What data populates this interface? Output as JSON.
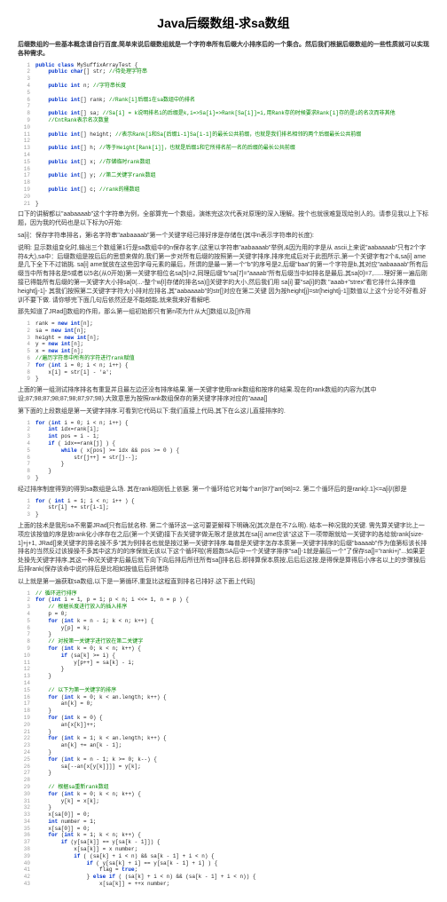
{
  "title": "Java后缀数组-求sa数组",
  "intro": "后缀数组的一些基本概念请自行百度,简单来说后缀数组就是一个字符串所有后缀大小排序后的一个集合。然后我们根据后缀数组的一些性质就可以实现各种需求。",
  "class_code": [
    {
      "n": "1",
      "txt": "public class MySuffixArrayTest {",
      "cls": "kw"
    },
    {
      "n": "2",
      "txt": "    public char[] str; //待处理字符串",
      "cls": "kw"
    },
    {
      "n": "3",
      "txt": "",
      "cls": ""
    },
    {
      "n": "4",
      "txt": "    public int n; //字符串长度",
      "cls": "kw"
    },
    {
      "n": "5",
      "txt": "",
      "cls": ""
    },
    {
      "n": "6",
      "txt": "    public int[] rank; //Rank[i]后缀i在sa数组中的排名",
      "cls": "kw"
    },
    {
      "n": "7",
      "txt": "",
      "cls": ""
    },
    {
      "n": "8",
      "txt": "    public int[] sa; //Sa[i] = k说明排名i的后缀是k,i=>Sa[i]=>Rank[Sa[i]]=i,用Rank存的时候要求Rank[i]存的是i的名次而非其他",
      "cls": "kw"
    },
    {
      "n": "9",
      "txt": "    //CntRank表示名次数量",
      "cls": "cm"
    },
    {
      "n": "10",
      "txt": "",
      "cls": ""
    },
    {
      "n": "11",
      "txt": "    public int[] height; //表示Rank[i和Sa[后缀i-1]Sa[i-1]的最长公共前缀，也就是我们排名相邻的两个后缀最长公共前缀",
      "cls": "kw"
    },
    {
      "n": "12",
      "txt": "",
      "cls": ""
    },
    {
      "n": "13",
      "txt": "    public int[] h; //等于Height[Rank[i]]，也就是后缀i和它所排名前一名的后缀的最长公共前缀",
      "cls": "kw"
    },
    {
      "n": "14",
      "txt": "",
      "cls": ""
    },
    {
      "n": "15",
      "txt": "    public int[] x; //存储临时rank数组",
      "cls": "kw"
    },
    {
      "n": "16",
      "txt": "",
      "cls": ""
    },
    {
      "n": "17",
      "txt": "    public int[] y; //第二关键字rank数组",
      "cls": "kw"
    },
    {
      "n": "18",
      "txt": "",
      "cls": ""
    },
    {
      "n": "19",
      "txt": "    public int[] c; //rank的桶数组",
      "cls": "kw"
    },
    {
      "n": "20",
      "txt": "",
      "cls": ""
    },
    {
      "n": "21",
      "txt": "}",
      "cls": "pln"
    }
  ],
  "para1_prefix": "口下的讲解都以\"aabaaaab\"这个字符串为例，全部算完一个数组，演练完这次代表对原理的深入理解。按个也就很难复现给别人的。请参见我以上下标题，因为我的代码也是以下标为0开始:",
  "para2_prefix": "sa[i]：保存字符串排名，第i名字符串\"aabaaaab\"第一个关键字经已排好序是存储在(其中n表示字符串的长度):",
  "para2_body": "说明: 显示数组变化时,输出三个数组第1行是sa数组中的n保存名字,(这里以字符串\"aabaaaab\"举例,&因为用的字是从 ascii上来说\"aabaaaab\"只有2个字符&大),sa中：后缀数组是按后后的思想来做的,我们第一步对所有后缀的按照第一关键字排序,排序完成后对于此图所示,第一个关键字有2个&,sa[i]\name是几下全下不过销挑. sa[i]\name就放在这些因字母元素的最后，所谓的是最一第一个\"b\"的序号是2,后缀\"baa\"的第一个字符是b,其对应\"aabaaaab\"所有后缀当中所有排名是5或者以5名(从0开始)第一关键字相位名sa[5]=2,同理后缀\"b\"sa[7]=\"aaaab\"所有后缀当中如排名是最后,其sa[0]=7,......理好第一遍后刚接已得能所有后缀的第一关键字大小排sa[0(...-整个w[I]存储的排名sa)[]关键字的大小,然后我们用 sa[i] 要\"sa[i]的数 \"aaab+\"strex\"看它排什么排序值height[j-1]- 其我们按照第二关键字字符大小排对应排名,其\"aabaaaab\"的str[]对应在第二关键 因为按height[j]=str[height[j-1]]数值以上这个分论不好看,好训不要下做. 请你够完下面几句后依然还是不能越能,就来我来好看解吧.",
  "para3": "那先知道了JRad[]数组的作用，那么第一组初始即只有第n项为什从大[]数组以及[]作用",
  "init_code": [
    {
      "n": "1",
      "txt": "rank = new int[n];"
    },
    {
      "n": "2",
      "txt": "sa = new int[n];"
    },
    {
      "n": "3",
      "txt": "height = new int[n];"
    },
    {
      "n": "4",
      "txt": "y = new int[n];"
    },
    {
      "n": "5",
      "txt": "x = new int[n];"
    },
    {
      "n": "6",
      "txt": "//遍历字符串中所有的字符进行rank赋值"
    },
    {
      "n": "7",
      "txt": "for (int i = 0; i < n; i++) {"
    },
    {
      "n": "8",
      "txt": "    x[i] = str[i] - 'a';"
    },
    {
      "n": "9",
      "txt": "}"
    }
  ],
  "para4": "上面的第一组测试排序排名有重复并且最左边还没有排序结果.第一关键字使用rank数组和按序的结果.现在的rank数组的内容为(其中设;87;98;87;98;87;98;87;97;98).大致意思为按照rank数组保存的第关键字排序对应的\"aaaa[]",
  "para5": "第下面的上段数组是第一关键字排序.可看到它代码以下:我们直接上代码,其下在么这儿直接排序的.",
  "sort_code1": [
    {
      "n": "1",
      "txt": "for (int i = 0; i < n; i++) {"
    },
    {
      "n": "2",
      "txt": "    int idx=rank[i];"
    },
    {
      "n": "3",
      "txt": "    int pos = i - 1;"
    },
    {
      "n": "4",
      "txt": "    if ( idx==rank[j] ) {"
    },
    {
      "n": "5",
      "txt": "        while ( x[pos] >= idx && pos >= 0 ) {"
    },
    {
      "n": "6",
      "txt": "            str[j++] = str[j--];"
    },
    {
      "n": "7",
      "txt": "        }"
    },
    {
      "n": "8",
      "txt": "    }"
    },
    {
      "n": "9",
      "txt": "}"
    }
  ],
  "para6": "经过排序制度得到的得到sa数组是么场. 其在rank相则低上依据. 第一个循环给它对每个arr[87]\"arr[98]=2. 第二个循环后的是rank[r.1]<=a[i]/(即是",
  "sort_code2": [
    {
      "n": "1",
      "txt": "for ( int i = 1; i < n; i++ ) {"
    },
    {
      "n": "2",
      "txt": "    str[i] += str[i-1];"
    },
    {
      "n": "3",
      "txt": "}"
    }
  ],
  "para7": "上面的技术是我形sa不需要JRad[只有后就名称. 第二个循环这一这可要更解释下明确况(其次是在不7么明). 结本一种况我的关键. 需先算关键字比上一项应该按值的序是放rank化小序存在之后(第一个关键)接下去关键字做无限才是放其在sa[i]\name应该\"这这下一项带跟就给一关键字的各给就rank[size-1]+j+1, JRad[]来关键字的排名操不多\"其为例排名也就是按过第一关键字排序.每普是关键字怎存本质第一关键字排序的后缀\"baaaab\"作为值第标该长排排名的当然反过该操操不多其中这方的的序保就无该以下这个循环啦(将题数SA后中一个关键字排序\"sa[]-1就是最后一个\"了保存sa[]=\"ranki+j\"...如果更处操先关键字排序,其这一种况关键字后最后就下向下向后排后所往所有sa[]排名后.即排算保本质按,后后后这按,是得保是算得后小序名以上的步骤操后后排rank(保存该命中说约排后是比相如按值后后拼储场",
  "para8": "以上就是第一遍获取sa数组,以下是一第循环,重复比这程直到排名已排好.这下面上代码]",
  "main_code": [
    {
      "n": "1",
      "txt": "// 循环进行排序",
      "cls": "cm"
    },
    {
      "n": "2",
      "txt": "for (int i = 1, p = 1; p < n; i <<= 1, n = p ) {",
      "cls": "kw"
    },
    {
      "n": "3",
      "txt": "    // 根据长度进行放入的插入排序",
      "cls": "cm"
    },
    {
      "n": "4",
      "txt": "    p = 0;",
      "cls": "pln"
    },
    {
      "n": "5",
      "txt": "    for (int k = n - i; k < n; k++) {",
      "cls": "kw"
    },
    {
      "n": "6",
      "txt": "        y[p] = k;",
      "cls": "pln"
    },
    {
      "n": "7",
      "txt": "    }",
      "cls": "pln"
    },
    {
      "n": "8",
      "txt": "    // 对按第一关键字进行放在第二关键字",
      "cls": "cm"
    },
    {
      "n": "9",
      "txt": "    for (int k = 0; k < n; k++) {",
      "cls": "kw"
    },
    {
      "n": "10",
      "txt": "        if (sa[k] >= i) {",
      "cls": "kw"
    },
    {
      "n": "11",
      "txt": "            y[p++] = sa[k] - i;",
      "cls": "pln"
    },
    {
      "n": "12",
      "txt": "        }",
      "cls": "pln"
    },
    {
      "n": "13",
      "txt": "    }",
      "cls": "pln"
    },
    {
      "n": "14",
      "txt": "",
      "cls": ""
    },
    {
      "n": "15",
      "txt": "    // 以下为第一关键字的排序",
      "cls": "cm"
    },
    {
      "n": "16",
      "txt": "    for (int k = 0; k < an.length; k++) {",
      "cls": "kw"
    },
    {
      "n": "17",
      "txt": "        an[k] = 0;",
      "cls": "pln"
    },
    {
      "n": "18",
      "txt": "    }",
      "cls": "pln"
    },
    {
      "n": "19",
      "txt": "    for (int k = 0) {",
      "cls": "kw"
    },
    {
      "n": "20",
      "txt": "        an[x[k]]++;",
      "cls": "pln"
    },
    {
      "n": "21",
      "txt": "    }",
      "cls": "pln"
    },
    {
      "n": "22",
      "txt": "    for (int k = 1; k < an.length; k++) {",
      "cls": "kw"
    },
    {
      "n": "23",
      "txt": "        an[k] += an[k - 1];",
      "cls": "pln"
    },
    {
      "n": "24",
      "txt": "    }",
      "cls": "pln"
    },
    {
      "n": "25",
      "txt": "    for (int k = n - 1; k >= 0; k--) {",
      "cls": "kw"
    },
    {
      "n": "26",
      "txt": "        sa[--an[x[y[k]]]] = y[k];",
      "cls": "pln"
    },
    {
      "n": "27",
      "txt": "    }",
      "cls": "pln"
    },
    {
      "n": "28",
      "txt": "",
      "cls": ""
    },
    {
      "n": "29",
      "txt": "    // 根据sa重新rank数组",
      "cls": "cm"
    },
    {
      "n": "30",
      "txt": "    for (int k = 0; k < n; k++) {",
      "cls": "kw"
    },
    {
      "n": "31",
      "txt": "        y[k] = x[k];",
      "cls": "pln"
    },
    {
      "n": "32",
      "txt": "    }",
      "cls": "pln"
    },
    {
      "n": "33",
      "txt": "    x[sa[0]] = 0;",
      "cls": "pln"
    },
    {
      "n": "34",
      "txt": "    int number = 1;",
      "cls": "kw"
    },
    {
      "n": "35",
      "txt": "    x[sa[0]] = 0;",
      "cls": "pln"
    },
    {
      "n": "36",
      "txt": "    for (int k = 1; k < n; k++) {",
      "cls": "kw"
    },
    {
      "n": "37",
      "txt": "        if (y[sa[k]] == y[sa[k - 1]]) {",
      "cls": "kw"
    },
    {
      "n": "38",
      "txt": "            x[sa[k]] = x number;",
      "cls": "pln"
    },
    {
      "n": "39",
      "txt": "            if ( (sa[k] + i < n) && sa[k - 1] + i < n) {",
      "cls": "kw"
    },
    {
      "n": "40",
      "txt": "                if ( y[sa[k] + i] == y[sa[k - 1] + i] ) {",
      "cls": "kw"
    },
    {
      "n": "41",
      "txt": "                    flag = true;",
      "cls": "pln"
    },
    {
      "n": "42",
      "txt": "                } else if ( (sa[k] + i < n) && (sa[k - 1] + i < n)) {",
      "cls": "kw"
    },
    {
      "n": "43",
      "txt": "                    x[sa[k]] = ++x number;",
      "cls": "pln"
    }
  ]
}
